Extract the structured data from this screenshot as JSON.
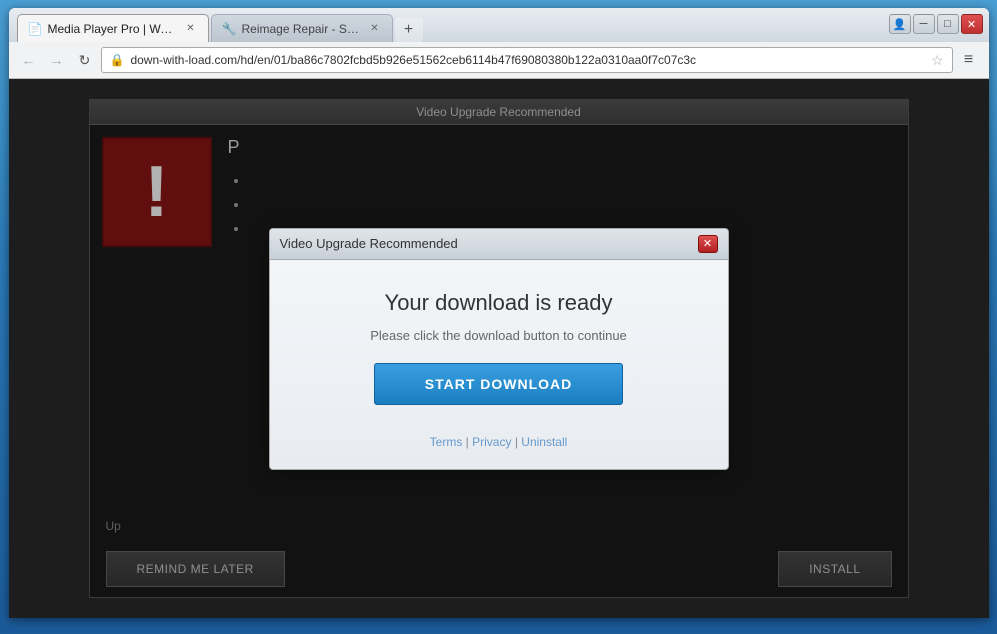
{
  "browser": {
    "tabs": [
      {
        "id": "tab1",
        "label": "Media Player Pro | Watch",
        "favicon": "📄",
        "active": true
      },
      {
        "id": "tab2",
        "label": "Reimage Repair - Speed ...",
        "favicon": "🔧",
        "active": false
      }
    ],
    "new_tab_label": "+",
    "nav": {
      "back_disabled": true,
      "forward_disabled": true,
      "reload_label": "↻",
      "address": "down-with-load.com/hd/en/01/ba86c7802fcbd5b926e51562ceb6114b47f69080380b122a0310aa0f7c07c3c",
      "lock_icon": "🔒",
      "star_icon": "☆",
      "menu_icon": "≡"
    },
    "window_controls": {
      "user": "👤",
      "minimize": "─",
      "maximize": "□",
      "close": "✕"
    }
  },
  "background_panel": {
    "header": "Video Upgrade Recommended",
    "warning_symbol": "!",
    "title": "P...",
    "bullets": [
      "•",
      "•",
      "•"
    ],
    "bottom_text": "Up...",
    "footer": {
      "remind_later": "REMIND ME LATER",
      "install": "INSTALL"
    }
  },
  "dialog": {
    "title": "Video Upgrade Recommended",
    "close_btn": "✕",
    "heading": "Your download is ready",
    "subtext": "Please click the download button to continue",
    "download_btn": "START DOWNLOAD",
    "links": {
      "terms": "Terms",
      "separator1": "|",
      "privacy": "Privacy",
      "separator2": "|",
      "uninstall": "Uninstall"
    }
  }
}
